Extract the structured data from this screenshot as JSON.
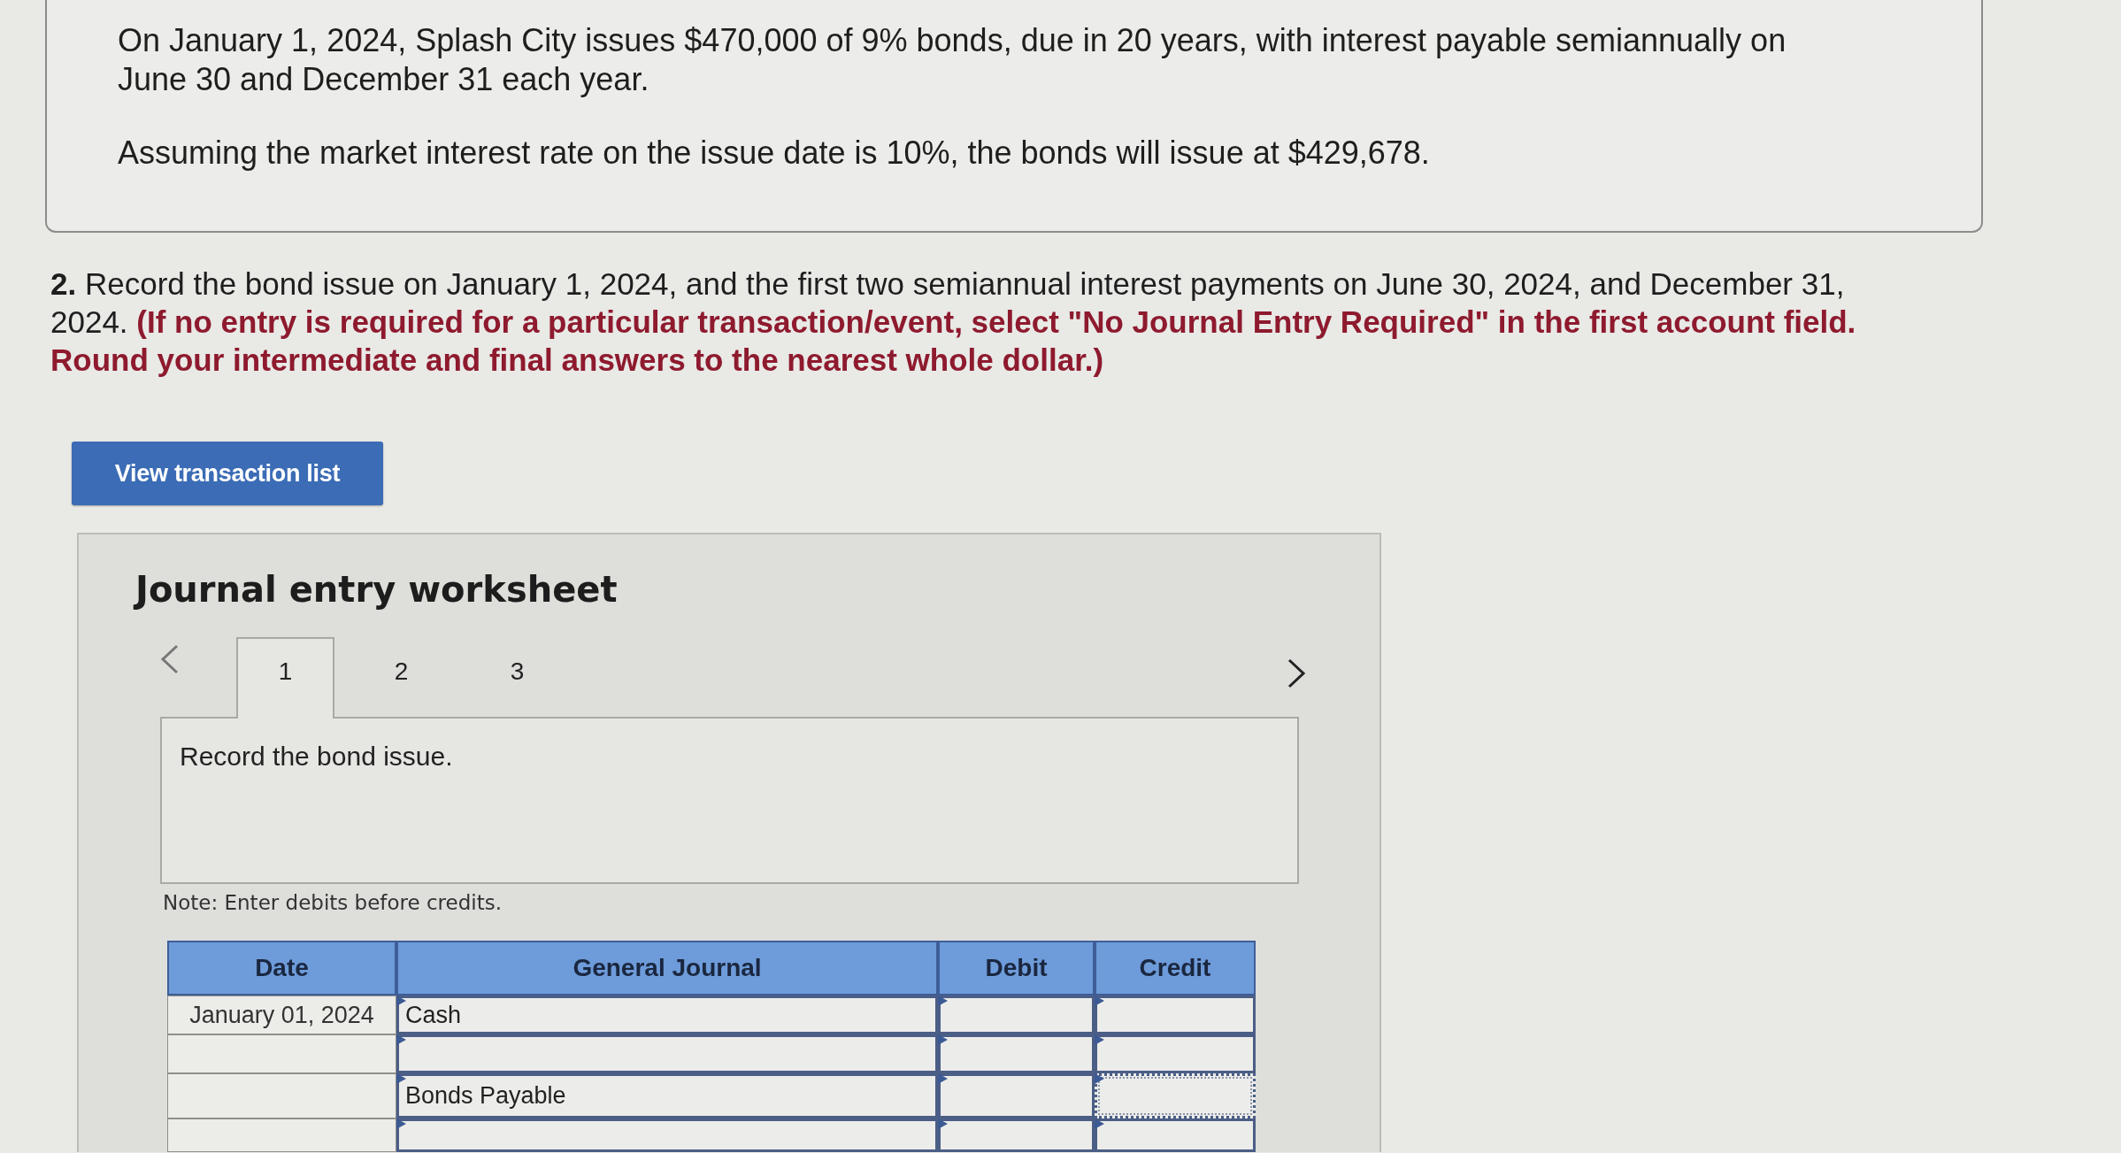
{
  "problem": {
    "paragraphs": [
      "On January 1, 2024, Splash City issues $470,000 of 9% bonds, due in 20 years, with interest payable semiannually on June 30 and December 31 each year.",
      "Assuming the market interest rate on the issue date is 10%, the bonds will issue at $429,678."
    ]
  },
  "question": {
    "number": "2.",
    "text": "Record the bond issue on January 1, 2024, and the first two semiannual interest payments on June 30, 2024, and December 31, 2024. **(If no entry is required for a particular transaction/event, select \"No Journal Entry Required\" in the first account field. Round your intermediate and final answers to the nearest whole dollar.)**"
  },
  "view_button": {
    "label": "View transaction list"
  },
  "worksheet": {
    "title": "Journal entry worksheet",
    "tabs": [
      {
        "label": "1",
        "selected": true
      },
      {
        "label": "2",
        "selected": false
      },
      {
        "label": "3",
        "selected": false
      }
    ],
    "description": "Record the bond issue.",
    "note": "Note: Enter debits before credits.",
    "table": {
      "columns": [
        "Date",
        "General Journal",
        "Debit",
        "Credit"
      ],
      "rows": [
        {
          "date": "January 01, 2024",
          "account": "Cash",
          "credit_focused": false
        },
        {
          "credit_focused": false
        },
        {
          "account": "Bonds Payable",
          "credit_focused": true
        },
        {
          "credit_focused": false
        }
      ]
    }
  }
}
